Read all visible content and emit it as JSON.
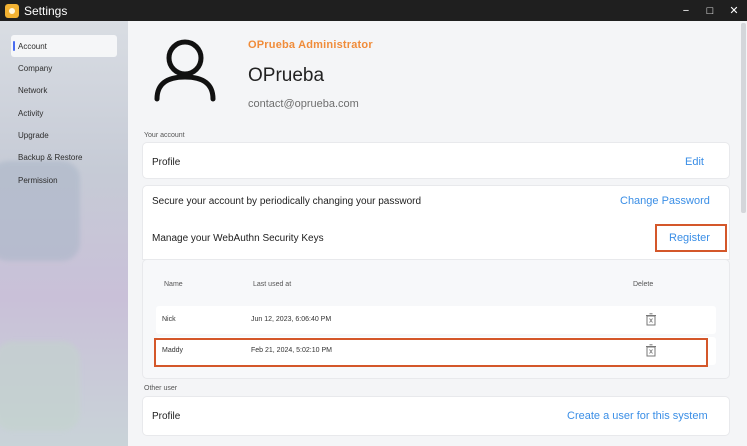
{
  "window": {
    "title": "Settings"
  },
  "sidebar": {
    "items": [
      {
        "label": "Account",
        "active": true
      },
      {
        "label": "Company"
      },
      {
        "label": "Network"
      },
      {
        "label": "Activity"
      },
      {
        "label": "Upgrade"
      },
      {
        "label": "Backup & Restore"
      },
      {
        "label": "Permission"
      }
    ]
  },
  "user": {
    "role": "OPrueba Administrator",
    "name": "OPrueba",
    "email": "contact@oprueba.com"
  },
  "your_account": {
    "section_label": "Your account",
    "profile_label": "Profile",
    "edit_link": "Edit",
    "password_text": "Secure your account by periodically changing your password",
    "change_password_link": "Change Password",
    "webauthn_text": "Manage your WebAuthn Security Keys",
    "register_link": "Register"
  },
  "security_keys": {
    "headers": {
      "name": "Name",
      "last_used": "Last used at",
      "delete": "Delete"
    },
    "rows": [
      {
        "name": "Nick",
        "last_used": "Jun 12, 2023, 6:06:40 PM"
      },
      {
        "name": "Maddy",
        "last_used": "Feb 21, 2024, 5:02:10 PM"
      }
    ]
  },
  "other_user": {
    "section_label": "Other user",
    "profile_label": "Profile",
    "create_link": "Create a user for this system"
  },
  "colors": {
    "accent_orange": "#f08c3a",
    "link_blue": "#3a8ee6",
    "highlight_red": "#d4572a"
  }
}
